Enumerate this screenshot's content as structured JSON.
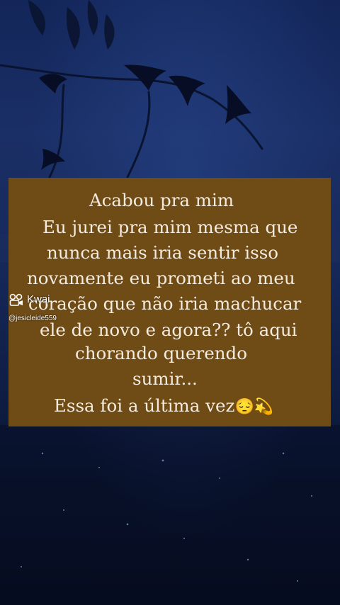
{
  "caption": {
    "lines": [
      "Acabou pra mim",
      "Eu jurei pra mim mesma que",
      "nunca mais iria sentir isso",
      "novamente eu prometi ao meu",
      "coração que não iria machucar",
      "ele de novo e agora?? tô aqui",
      "chorando querendo",
      "sumir...",
      "Essa foi a última vez"
    ],
    "emoji": "😔💫",
    "box_color": "#6f4b16",
    "text_color": "#f4ece0"
  },
  "watermark": {
    "brand": "Kwai",
    "handle": "@jesicleide559",
    "logo_icon": "kwai-logo-icon"
  }
}
